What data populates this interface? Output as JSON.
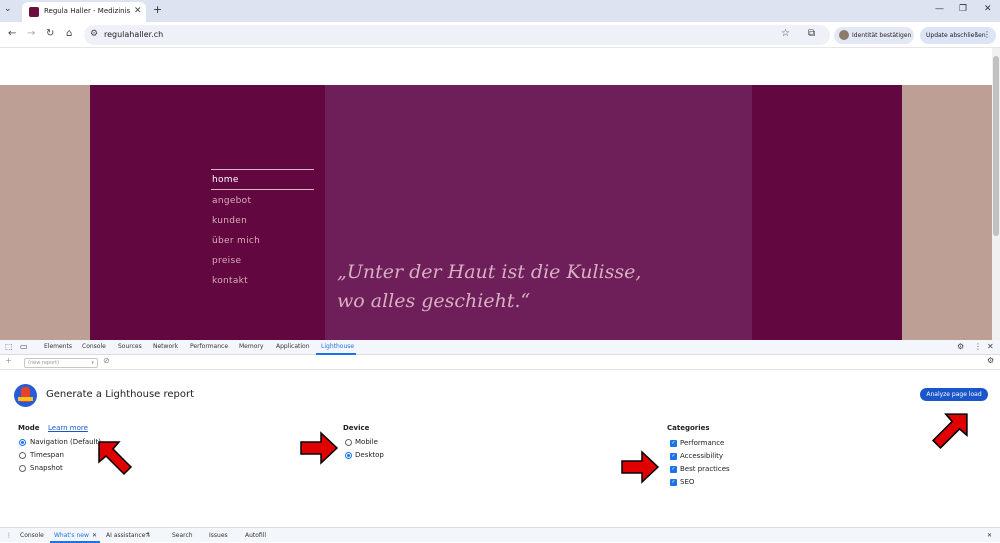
{
  "browser": {
    "tab_title": "Regula Haller - Medizinische M",
    "tab_close": "✕",
    "new_tab": "+",
    "url": "regulahaller.ch",
    "identity_label": "Identität bestätigen",
    "update_label": "Update abschließen",
    "icons": [
      "tab-list-icon",
      "back-icon",
      "forward-icon",
      "reload-icon",
      "home-icon",
      "site-info-icon",
      "star-icon",
      "extensions-icon",
      "kebab-icon",
      "minimize-icon",
      "restore-icon",
      "close-icon"
    ]
  },
  "website": {
    "nav": [
      "home",
      "angebot",
      "kunden",
      "über mich",
      "preise",
      "kontakt"
    ],
    "active_nav": "home",
    "quote_line1": "„Unter der Haut ist die Kulisse,",
    "quote_line2": "wo alles geschieht.“",
    "colors": {
      "outer": "#bd9f95",
      "dark": "#62073f",
      "mid": "#6e1f59",
      "quote": "#d7b0c2"
    }
  },
  "devtools": {
    "tabs": [
      "Elements",
      "Console",
      "Sources",
      "Network",
      "Performance",
      "Memory",
      "Application",
      "Lighthouse"
    ],
    "active_tab": "Lighthouse",
    "report_select": "(new report)",
    "lighthouse": {
      "title": "Generate a Lighthouse report",
      "analyze_button": "Analyze page load",
      "mode": {
        "label": "Mode",
        "learn_more": "Learn more",
        "options": [
          "Navigation (Default)",
          "Timespan",
          "Snapshot"
        ],
        "selected": "Navigation (Default)"
      },
      "device": {
        "label": "Device",
        "options": [
          "Mobile",
          "Desktop"
        ],
        "selected": "Desktop"
      },
      "categories": {
        "label": "Categories",
        "options": [
          "Performance",
          "Accessibility",
          "Best practices",
          "SEO"
        ],
        "checked": [
          true,
          true,
          true,
          true
        ]
      }
    },
    "drawer": {
      "tabs": [
        "Console",
        "What's new",
        "AI assistance",
        "Search",
        "Issues",
        "Autofill"
      ],
      "active_tab": "What's new",
      "close": "✕"
    }
  },
  "annotation_arrow_color": "#e00000"
}
